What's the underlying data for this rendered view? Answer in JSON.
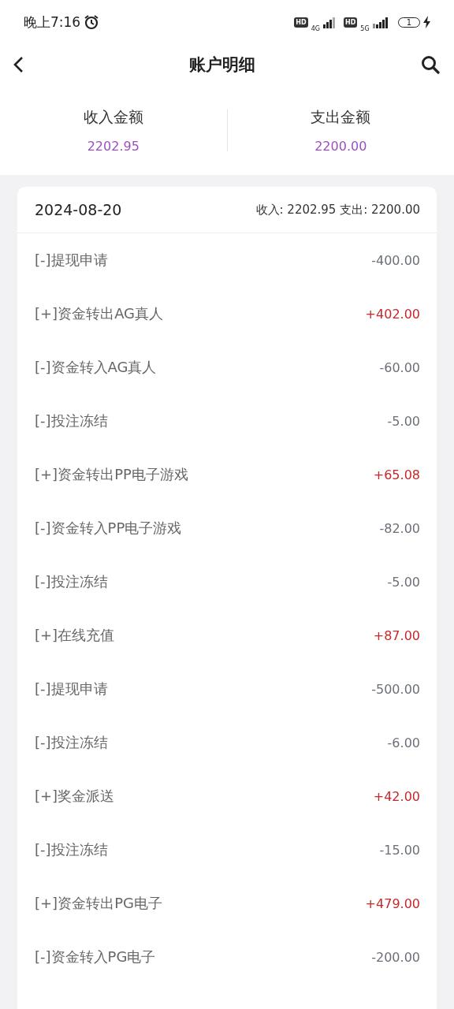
{
  "status_bar": {
    "time": "晚上7:16",
    "battery": "1",
    "network_1": "4G",
    "network_2": "5G",
    "hd_1": "HD",
    "hd_2": "HD"
  },
  "header": {
    "title": "账户明细"
  },
  "summary": [
    {
      "label": "收入金额",
      "value": "2202.95"
    },
    {
      "label": "支出金额",
      "value": "2200.00"
    }
  ],
  "day": {
    "date": "2024-08-20",
    "totals": "收入: 2202.95 支出: 2200.00",
    "rows": [
      {
        "label": "[-]提现申请",
        "amount": "-400.00",
        "kind": "expense"
      },
      {
        "label": "[+]资金转出AG真人",
        "amount": "+402.00",
        "kind": "income"
      },
      {
        "label": "[-]资金转入AG真人",
        "amount": "-60.00",
        "kind": "expense"
      },
      {
        "label": "[-]投注冻结",
        "amount": "-5.00",
        "kind": "expense"
      },
      {
        "label": "[+]资金转出PP电子游戏",
        "amount": "+65.08",
        "kind": "income"
      },
      {
        "label": "[-]资金转入PP电子游戏",
        "amount": "-82.00",
        "kind": "expense"
      },
      {
        "label": "[-]投注冻结",
        "amount": "-5.00",
        "kind": "expense"
      },
      {
        "label": "[+]在线充值",
        "amount": "+87.00",
        "kind": "income"
      },
      {
        "label": "[-]提现申请",
        "amount": "-500.00",
        "kind": "expense"
      },
      {
        "label": "[-]投注冻结",
        "amount": "-6.00",
        "kind": "expense"
      },
      {
        "label": "[+]奖金派送",
        "amount": "+42.00",
        "kind": "income"
      },
      {
        "label": "[-]投注冻结",
        "amount": "-15.00",
        "kind": "expense"
      },
      {
        "label": "[+]资金转出PG电子",
        "amount": "+479.00",
        "kind": "income"
      },
      {
        "label": "[-]资金转入PG电子",
        "amount": "-200.00",
        "kind": "expense"
      }
    ]
  }
}
